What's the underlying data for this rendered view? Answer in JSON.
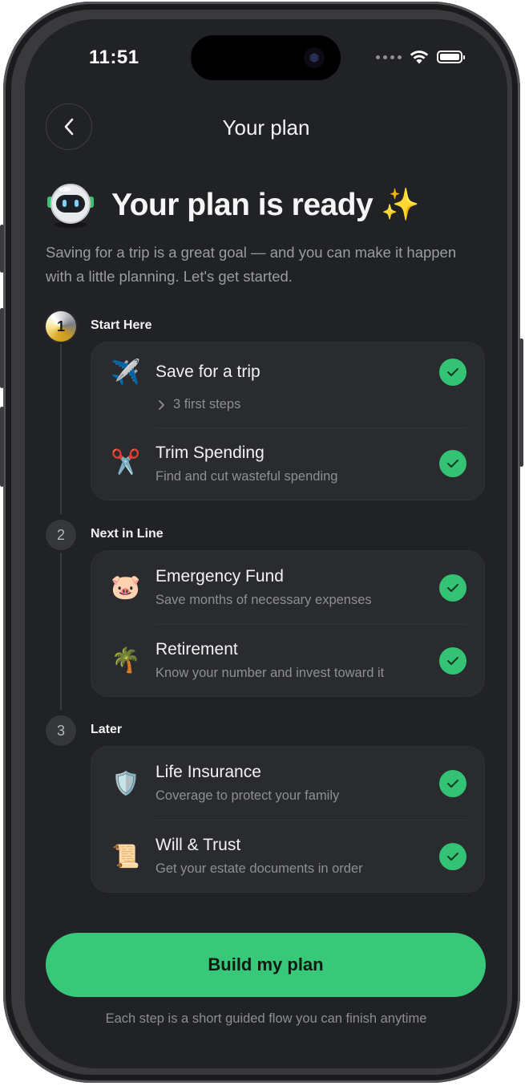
{
  "status_bar": {
    "time": "11:51"
  },
  "nav": {
    "title": "Your plan",
    "back_icon": "chevron-left-icon"
  },
  "hero": {
    "title": "Your plan is ready",
    "emoji": "✨",
    "intro": "Saving for a trip is a great goal — and you can make it happen with a little planning. Let's get started."
  },
  "sections": [
    {
      "number": "1",
      "label": "Start Here",
      "items": [
        {
          "emoji": "✈️",
          "title": "Save for a trip",
          "subtitle": "3 first steps",
          "expandable": true,
          "checked": true
        },
        {
          "emoji": "✂️",
          "title": "Trim Spending",
          "subtitle": "Find and cut wasteful spending",
          "checked": true
        }
      ]
    },
    {
      "number": "2",
      "label": "Next in Line",
      "items": [
        {
          "emoji": "🐷",
          "title": "Emergency Fund",
          "subtitle": "Save months of necessary expenses",
          "checked": true
        },
        {
          "emoji": "🌴",
          "title": "Retirement",
          "subtitle": "Know your number and invest toward it",
          "checked": true
        }
      ]
    },
    {
      "number": "3",
      "label": "Later",
      "items": [
        {
          "emoji": "🛡️",
          "title": "Life Insurance",
          "subtitle": "Coverage to protect your family",
          "checked": true
        },
        {
          "emoji": "📜",
          "title": "Will & Trust",
          "subtitle": "Get your estate documents in order",
          "checked": true
        }
      ]
    }
  ],
  "cta": {
    "label": "Build my plan"
  },
  "footnote": "Each step is a short guided flow you can finish anytime",
  "colors": {
    "accent": "#38c879",
    "background": "#212225",
    "card": "#2a2b2f"
  }
}
